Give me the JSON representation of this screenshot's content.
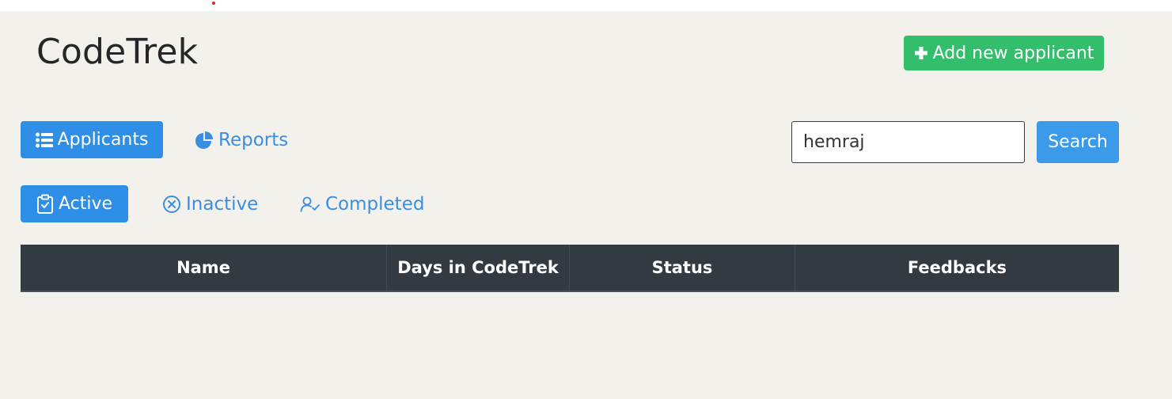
{
  "header": {
    "app_title": "CodeTrek",
    "add_button_label": "Add new applicant",
    "add_button_icon": "plus-icon"
  },
  "nav": {
    "applicants_label": "Applicants",
    "applicants_icon": "list-icon",
    "reports_label": "Reports",
    "reports_icon": "pie-chart-icon"
  },
  "search": {
    "value": "hemraj",
    "button_label": "Search"
  },
  "filters": {
    "active_label": "Active",
    "active_icon": "clipboard-check-icon",
    "inactive_label": "Inactive",
    "inactive_icon": "circle-x-icon",
    "completed_label": "Completed",
    "completed_icon": "user-check-icon"
  },
  "table": {
    "columns": [
      "Name",
      "Days in CodeTrek",
      "Status",
      "Feedbacks"
    ]
  },
  "colors": {
    "background": "#f3f1ec",
    "primary": "#2f8ee5",
    "success": "#33be6b",
    "table_header": "#343a42",
    "link": "#3a8ee0"
  }
}
